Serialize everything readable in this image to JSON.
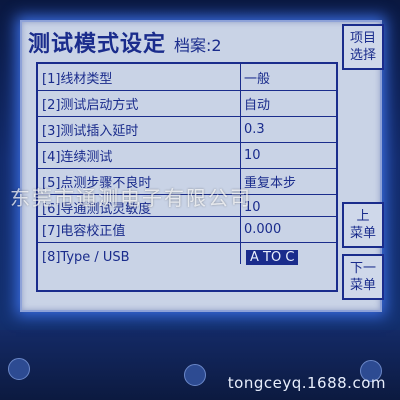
{
  "screen": {
    "title": "测试模式设定",
    "file_label": "档案:2"
  },
  "settings": [
    {
      "label": "[1]线材类型",
      "value": "一般"
    },
    {
      "label": "[2]测试启动方式",
      "value": "自动"
    },
    {
      "label": "[3]测试插入延时",
      "value": "0.3"
    },
    {
      "label": "[4]连续测试",
      "value": "10"
    },
    {
      "label": "[5]点测步骤不良时",
      "value": "重复本步"
    },
    {
      "label": "[6]导通测试灵敏度",
      "value": "10"
    },
    {
      "label": "[7]电容校正值",
      "value": "0.000"
    },
    {
      "label": "[8]Type / USB",
      "value": "A TO C"
    }
  ],
  "side_buttons": {
    "select_item": {
      "line1": "项目",
      "line2": "选择"
    },
    "page_up": {
      "line1": "上",
      "line2": "菜单"
    },
    "page_down": {
      "line1": "下一",
      "line2": "菜单"
    }
  },
  "watermark": "东莞市通测电子有限公司",
  "footer_url": "tongceyq.1688.com",
  "colors": {
    "screen_bg": "#c9d3e6",
    "text": "#1a2c8c",
    "backlight": "#3a6ce0",
    "bezel": "#122a6a"
  }
}
